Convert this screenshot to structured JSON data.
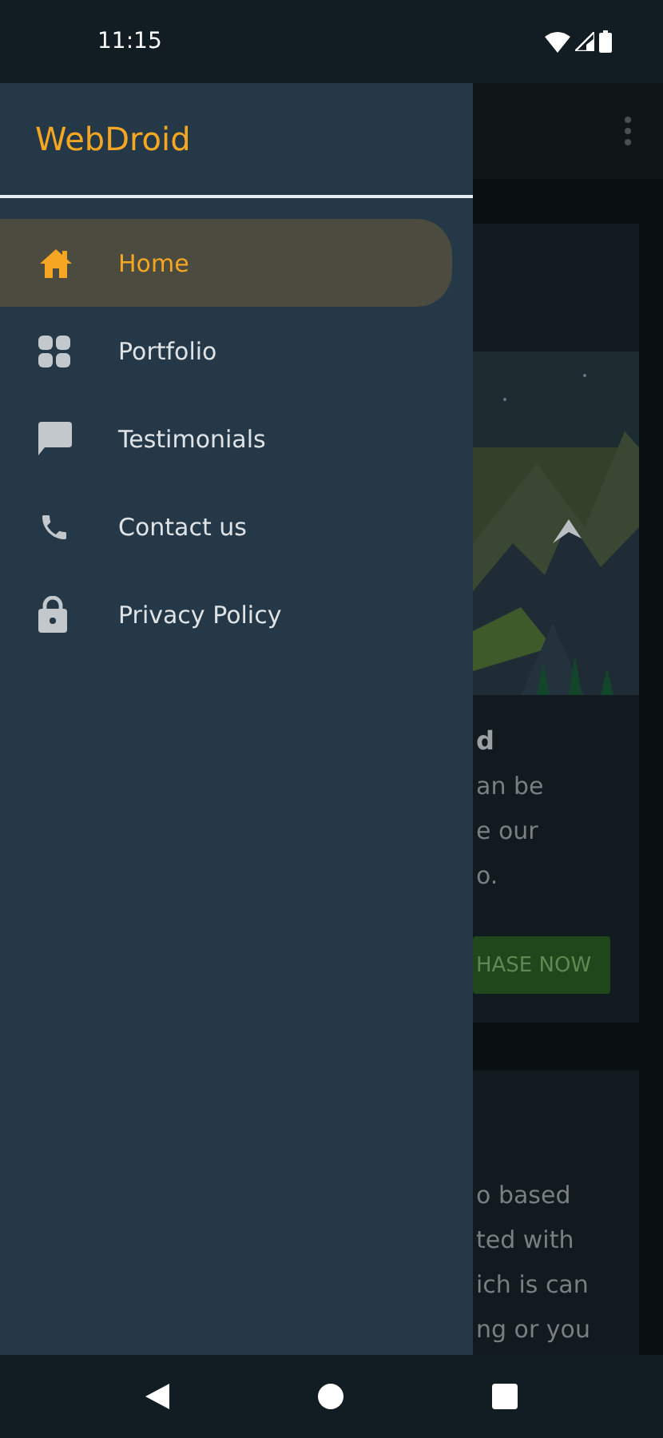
{
  "status_bar": {
    "time": "11:15"
  },
  "drawer": {
    "title": "WebDroid",
    "items": [
      {
        "label": "Home",
        "selected": true
      },
      {
        "label": "Portfolio",
        "selected": false
      },
      {
        "label": "Testimonials",
        "selected": false
      },
      {
        "label": "Contact us",
        "selected": false
      },
      {
        "label": "Privacy Policy",
        "selected": false
      }
    ]
  },
  "background": {
    "card_1": {
      "picture": {
        "kind": "picture"
      },
      "heading": "d",
      "lines": [
        "an be",
        "e our",
        "o."
      ],
      "button": "HASE NOW"
    },
    "card_2": {
      "lines": [
        "o based",
        "ted with",
        "ich is can",
        "ng or you"
      ]
    }
  }
}
